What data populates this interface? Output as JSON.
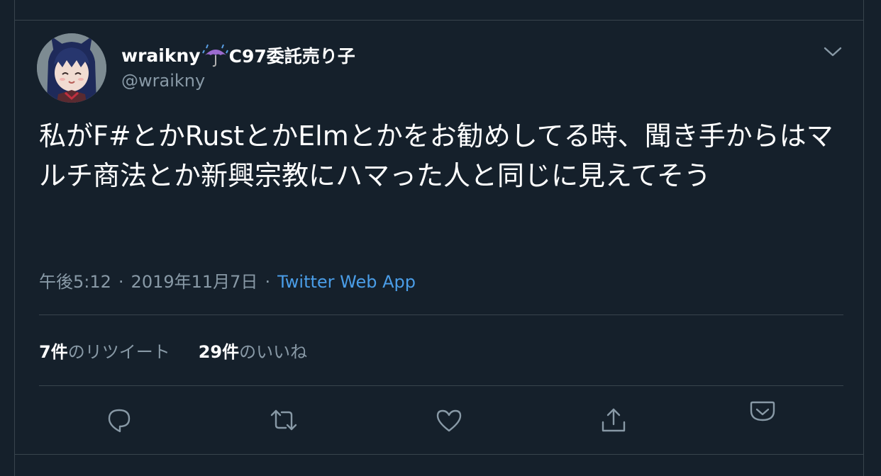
{
  "tweet": {
    "display_name": "wraikny",
    "display_name_suffix": "C97委託売り子",
    "handle": "@wraikny",
    "text": "私がF#とかRustとかElmとかをお勧めしてる時、聞き手からはマルチ商法とか新興宗教にハマった人と同じに見えてそう",
    "time": "午後5:12",
    "date": "2019年11月7日",
    "source": "Twitter Web App",
    "separator": "·"
  },
  "stats": {
    "retweets_count": "7件",
    "retweets_label": "のリツイート",
    "likes_count": "29件",
    "likes_label": "のいいね"
  },
  "colors": {
    "background": "#15202b",
    "border": "#38444d",
    "text_primary": "#ffffff",
    "text_secondary": "#8899a6",
    "link": "#4a9de7"
  },
  "icons": {
    "umbrella": "umbrella-with-rain-icon",
    "chevron": "chevron-down-icon",
    "reply": "reply-icon",
    "retweet": "retweet-icon",
    "like": "heart-icon",
    "share": "share-icon",
    "bookmark": "pocket-icon"
  }
}
